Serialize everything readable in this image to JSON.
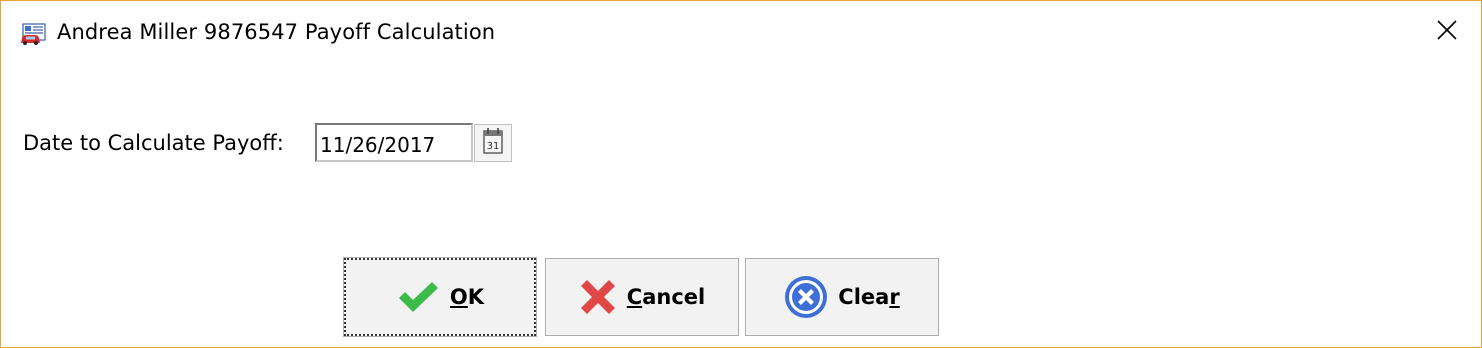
{
  "window": {
    "title": "Andrea Miller 9876547 Payoff Calculation",
    "app_icon": "car-document-icon",
    "close_icon": "close-icon",
    "border_color": "#e8a43a"
  },
  "form": {
    "date_label": "Date to Calculate Payoff:",
    "date_value": "11/26/2017",
    "calendar_icon": "calendar-icon",
    "calendar_day": "31"
  },
  "buttons": {
    "ok": {
      "label_ul": "O",
      "label_rest": "K",
      "icon": "check-icon",
      "icon_color": "#3dbb4a"
    },
    "cancel": {
      "label_ul": "C",
      "label_rest": "ancel",
      "icon": "x-icon",
      "icon_color": "#e04848"
    },
    "clear": {
      "label_pre": "Clea",
      "label_ul": "r",
      "icon": "clear-circle-icon",
      "icon_color": "#3d6fd6"
    }
  }
}
